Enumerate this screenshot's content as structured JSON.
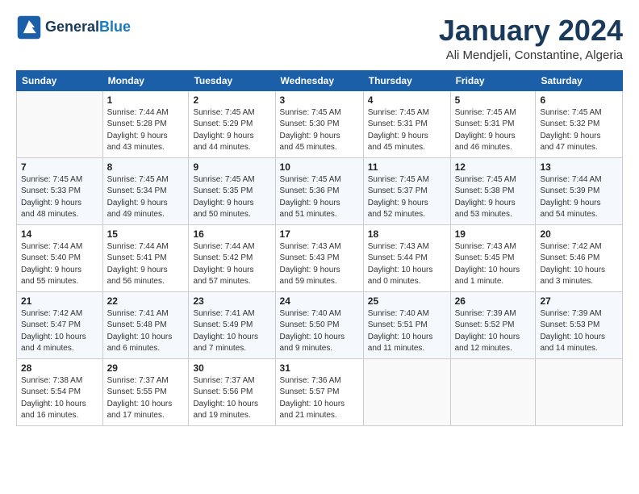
{
  "header": {
    "logo_line1": "General",
    "logo_line2": "Blue",
    "title": "January 2024",
    "subtitle": "Ali Mendjeli, Constantine, Algeria"
  },
  "columns": [
    "Sunday",
    "Monday",
    "Tuesday",
    "Wednesday",
    "Thursday",
    "Friday",
    "Saturday"
  ],
  "weeks": [
    [
      {
        "day": "",
        "info": ""
      },
      {
        "day": "1",
        "info": "Sunrise: 7:44 AM\nSunset: 5:28 PM\nDaylight: 9 hours\nand 43 minutes."
      },
      {
        "day": "2",
        "info": "Sunrise: 7:45 AM\nSunset: 5:29 PM\nDaylight: 9 hours\nand 44 minutes."
      },
      {
        "day": "3",
        "info": "Sunrise: 7:45 AM\nSunset: 5:30 PM\nDaylight: 9 hours\nand 45 minutes."
      },
      {
        "day": "4",
        "info": "Sunrise: 7:45 AM\nSunset: 5:31 PM\nDaylight: 9 hours\nand 45 minutes."
      },
      {
        "day": "5",
        "info": "Sunrise: 7:45 AM\nSunset: 5:31 PM\nDaylight: 9 hours\nand 46 minutes."
      },
      {
        "day": "6",
        "info": "Sunrise: 7:45 AM\nSunset: 5:32 PM\nDaylight: 9 hours\nand 47 minutes."
      }
    ],
    [
      {
        "day": "7",
        "info": "Sunrise: 7:45 AM\nSunset: 5:33 PM\nDaylight: 9 hours\nand 48 minutes."
      },
      {
        "day": "8",
        "info": "Sunrise: 7:45 AM\nSunset: 5:34 PM\nDaylight: 9 hours\nand 49 minutes."
      },
      {
        "day": "9",
        "info": "Sunrise: 7:45 AM\nSunset: 5:35 PM\nDaylight: 9 hours\nand 50 minutes."
      },
      {
        "day": "10",
        "info": "Sunrise: 7:45 AM\nSunset: 5:36 PM\nDaylight: 9 hours\nand 51 minutes."
      },
      {
        "day": "11",
        "info": "Sunrise: 7:45 AM\nSunset: 5:37 PM\nDaylight: 9 hours\nand 52 minutes."
      },
      {
        "day": "12",
        "info": "Sunrise: 7:45 AM\nSunset: 5:38 PM\nDaylight: 9 hours\nand 53 minutes."
      },
      {
        "day": "13",
        "info": "Sunrise: 7:44 AM\nSunset: 5:39 PM\nDaylight: 9 hours\nand 54 minutes."
      }
    ],
    [
      {
        "day": "14",
        "info": "Sunrise: 7:44 AM\nSunset: 5:40 PM\nDaylight: 9 hours\nand 55 minutes."
      },
      {
        "day": "15",
        "info": "Sunrise: 7:44 AM\nSunset: 5:41 PM\nDaylight: 9 hours\nand 56 minutes."
      },
      {
        "day": "16",
        "info": "Sunrise: 7:44 AM\nSunset: 5:42 PM\nDaylight: 9 hours\nand 57 minutes."
      },
      {
        "day": "17",
        "info": "Sunrise: 7:43 AM\nSunset: 5:43 PM\nDaylight: 9 hours\nand 59 minutes."
      },
      {
        "day": "18",
        "info": "Sunrise: 7:43 AM\nSunset: 5:44 PM\nDaylight: 10 hours\nand 0 minutes."
      },
      {
        "day": "19",
        "info": "Sunrise: 7:43 AM\nSunset: 5:45 PM\nDaylight: 10 hours\nand 1 minute."
      },
      {
        "day": "20",
        "info": "Sunrise: 7:42 AM\nSunset: 5:46 PM\nDaylight: 10 hours\nand 3 minutes."
      }
    ],
    [
      {
        "day": "21",
        "info": "Sunrise: 7:42 AM\nSunset: 5:47 PM\nDaylight: 10 hours\nand 4 minutes."
      },
      {
        "day": "22",
        "info": "Sunrise: 7:41 AM\nSunset: 5:48 PM\nDaylight: 10 hours\nand 6 minutes."
      },
      {
        "day": "23",
        "info": "Sunrise: 7:41 AM\nSunset: 5:49 PM\nDaylight: 10 hours\nand 7 minutes."
      },
      {
        "day": "24",
        "info": "Sunrise: 7:40 AM\nSunset: 5:50 PM\nDaylight: 10 hours\nand 9 minutes."
      },
      {
        "day": "25",
        "info": "Sunrise: 7:40 AM\nSunset: 5:51 PM\nDaylight: 10 hours\nand 11 minutes."
      },
      {
        "day": "26",
        "info": "Sunrise: 7:39 AM\nSunset: 5:52 PM\nDaylight: 10 hours\nand 12 minutes."
      },
      {
        "day": "27",
        "info": "Sunrise: 7:39 AM\nSunset: 5:53 PM\nDaylight: 10 hours\nand 14 minutes."
      }
    ],
    [
      {
        "day": "28",
        "info": "Sunrise: 7:38 AM\nSunset: 5:54 PM\nDaylight: 10 hours\nand 16 minutes."
      },
      {
        "day": "29",
        "info": "Sunrise: 7:37 AM\nSunset: 5:55 PM\nDaylight: 10 hours\nand 17 minutes."
      },
      {
        "day": "30",
        "info": "Sunrise: 7:37 AM\nSunset: 5:56 PM\nDaylight: 10 hours\nand 19 minutes."
      },
      {
        "day": "31",
        "info": "Sunrise: 7:36 AM\nSunset: 5:57 PM\nDaylight: 10 hours\nand 21 minutes."
      },
      {
        "day": "",
        "info": ""
      },
      {
        "day": "",
        "info": ""
      },
      {
        "day": "",
        "info": ""
      }
    ]
  ]
}
